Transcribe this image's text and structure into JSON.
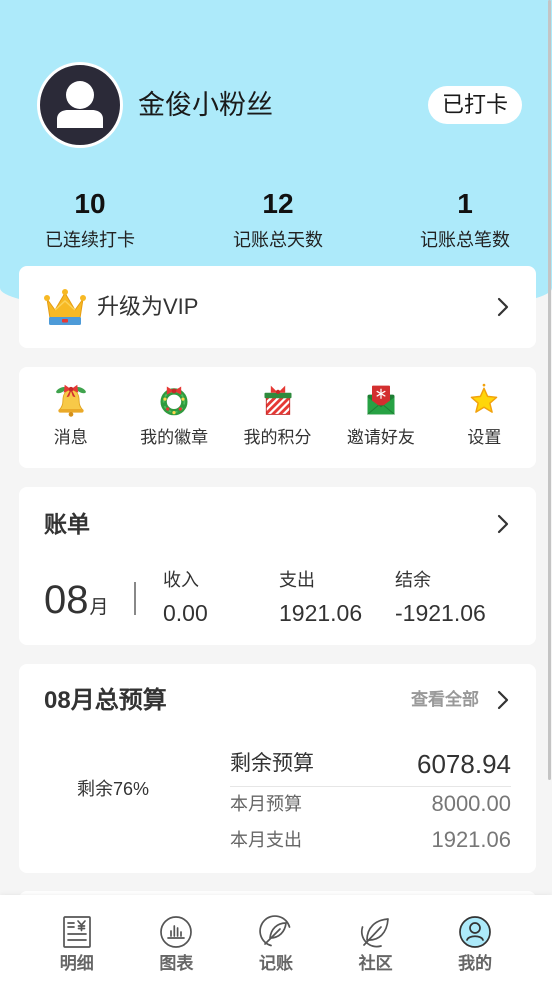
{
  "colors": {
    "header_bg": "#adeafa",
    "page_bg": "#f5f5f5",
    "active_tab": "#adeafa"
  },
  "header": {
    "avatar_icon": "person-icon",
    "username": "金俊小粉丝",
    "checkin_label": "已打卡"
  },
  "stats": [
    {
      "value": "10",
      "label": "已连续打卡"
    },
    {
      "value": "12",
      "label": "记账总天数"
    },
    {
      "value": "1",
      "label": "记账总笔数"
    }
  ],
  "vip": {
    "icon": "crown-icon",
    "label": "升级为VIP"
  },
  "shortcuts": [
    {
      "label": "消息",
      "icon": "bell-icon"
    },
    {
      "label": "我的徽章",
      "icon": "wreath-icon"
    },
    {
      "label": "我的积分",
      "icon": "gift-icon"
    },
    {
      "label": "邀请好友",
      "icon": "envelope-icon"
    },
    {
      "label": "设置",
      "icon": "star-icon"
    }
  ],
  "bill": {
    "title": "账单",
    "month": "08",
    "month_unit": "月",
    "items": [
      {
        "label": "收入",
        "value": "0.00"
      },
      {
        "label": "支出",
        "value": "1921.06"
      },
      {
        "label": "结余",
        "value": "-1921.06"
      }
    ]
  },
  "budget": {
    "title": "08月总预算",
    "view_all": "查看全部",
    "remaining_summary": "剩余76%",
    "remaining_label": "剩余预算",
    "remaining_value": "6078.94",
    "monthly_budget_label": "本月预算",
    "monthly_budget_value": "8000.00",
    "monthly_spend_label": "本月支出",
    "monthly_spend_value": "1921.06"
  },
  "tabbar": [
    {
      "label": "明细",
      "icon": "receipt-icon",
      "active": false
    },
    {
      "label": "图表",
      "icon": "bar-chart-icon",
      "active": false
    },
    {
      "label": "记账",
      "icon": "leaf-circle-icon",
      "active": false
    },
    {
      "label": "社区",
      "icon": "leaf-icon",
      "active": false
    },
    {
      "label": "我的",
      "icon": "user-circle-icon",
      "active": true
    }
  ]
}
